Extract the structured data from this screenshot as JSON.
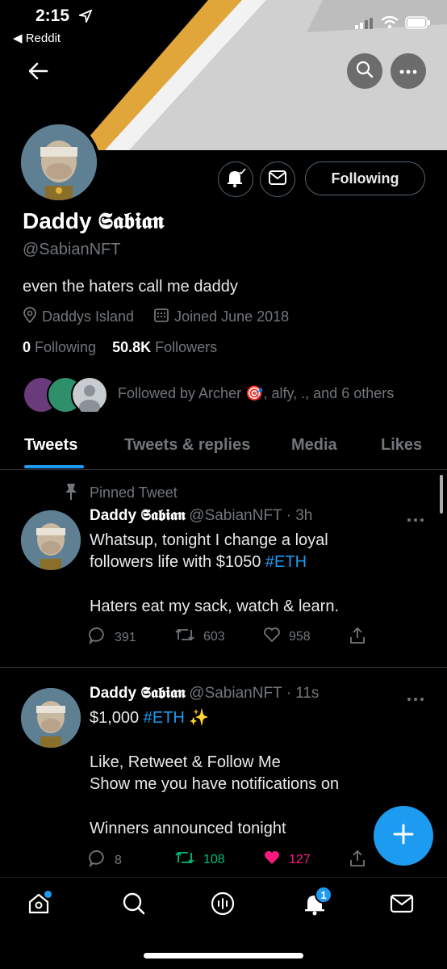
{
  "status_bar": {
    "time": "2:15",
    "back_app": "Reddit"
  },
  "profile": {
    "display_name": "Daddy 𝕾𝖆𝖇𝖎𝖆𝖓",
    "handle": "@SabianNFT",
    "bio": "even the haters call me daddy",
    "location": "Daddys Island",
    "joined": "Joined June 2018",
    "following_count": "0",
    "following_label": "Following",
    "followers_count": "50.8K",
    "followers_label": "Followers",
    "followed_by": "Followed by Archer 🎯, alfy, ., and 6 others",
    "following_button": "Following"
  },
  "tabs": [
    {
      "label": "Tweets",
      "active": true
    },
    {
      "label": "Tweets & replies",
      "active": false
    },
    {
      "label": "Media",
      "active": false
    },
    {
      "label": "Likes",
      "active": false
    }
  ],
  "tweets": [
    {
      "pinned_label": "Pinned Tweet",
      "name": "Daddy 𝕾𝖆𝖇𝖎𝖆𝖓",
      "handle_time": "@SabianNFT · 3h",
      "line1": "Whatsup, tonight I change a loyal",
      "line2_text": "followers life with $1050 ",
      "line2_hashtag": "#ETH",
      "line3": "Haters eat my sack, watch & learn.",
      "replies": "391",
      "retweets": "603",
      "likes": "958"
    },
    {
      "name": "Daddy 𝕾𝖆𝖇𝖎𝖆𝖓",
      "handle_time": "@SabianNFT · 11s",
      "line1_text": "$1,000 ",
      "line1_hashtag": "#ETH",
      "line1_emoji": "✨",
      "line2": "Like, Retweet & Follow Me",
      "line3": "Show me you have notifications on",
      "line4": "Winners announced tonight",
      "replies": "8",
      "retweets": "108",
      "likes": "127"
    }
  ],
  "notifications_badge": "1",
  "colors": {
    "accent": "#1d9bf0",
    "like": "#f91880",
    "retweet": "#00ba7c",
    "muted": "#71767b"
  }
}
